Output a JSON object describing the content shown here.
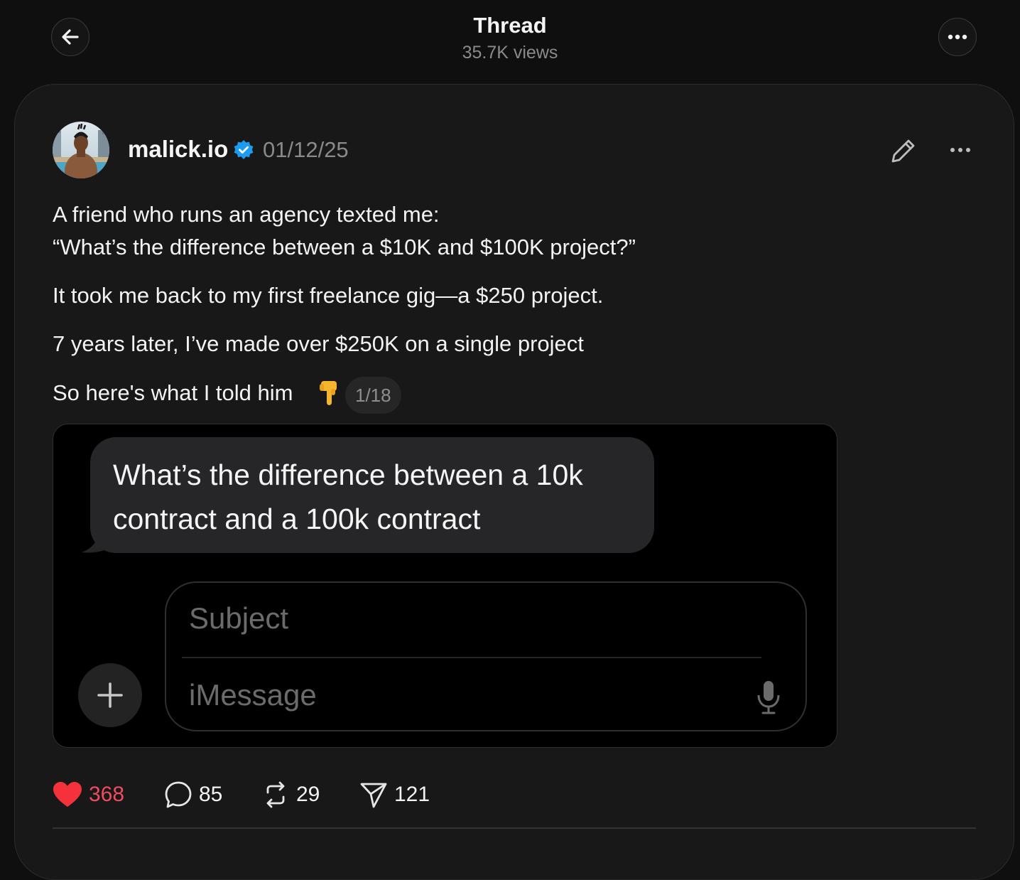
{
  "header": {
    "title": "Thread",
    "views": "35.7K views",
    "back_icon": "arrow-left-icon",
    "more_icon": "ellipsis-icon"
  },
  "post": {
    "author": "malick.io",
    "verified": true,
    "date": "01/12/25",
    "lines": [
      "A friend who runs an agency texted me:",
      "“What’s the difference between a $10K and $100K project?”",
      "It took me back to my first freelance gig—a $250 project.",
      "7 years later, I’ve made over $250K on a single project",
      "So here's what I told him"
    ],
    "thread_counter": "1/18"
  },
  "media": {
    "bubble_text": "What’s the difference between a 10k contract and a 100k contract",
    "subject_placeholder": "Subject",
    "message_placeholder": "iMessage"
  },
  "actions": {
    "likes": "368",
    "replies": "85",
    "reposts": "29",
    "shares": "121"
  },
  "colors": {
    "background": "#0f0f0f",
    "card": "#181818",
    "like": "#f24a5e",
    "verified": "#1d9bf0",
    "muted": "#8a8a8a"
  }
}
